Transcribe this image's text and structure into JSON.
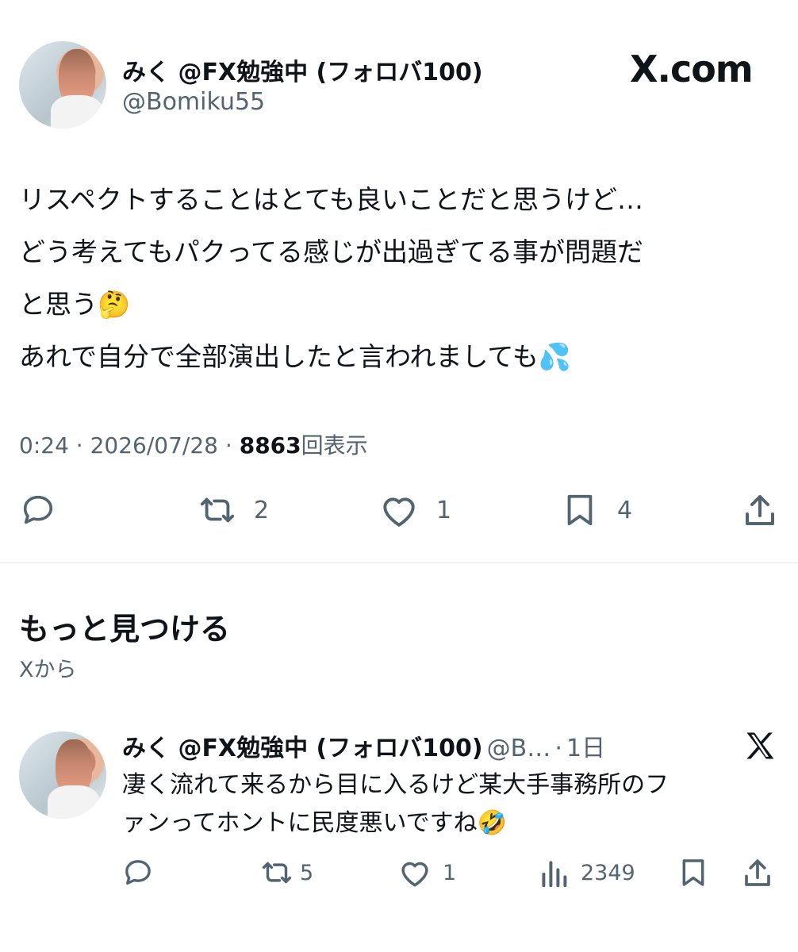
{
  "tweet": {
    "name": "みく @FX勉強中 (フォロバ100)",
    "handle": "@Bomiku55",
    "brand": "X.com",
    "lines": [
      "リスペクトすることはとても良いことだと思うけど…",
      "どう考えてもパクってる感じが出過ぎてる事が問題だ",
      "と思う🤔",
      "あれで自分で全部演出したと言われましても💦"
    ],
    "time": "0:24",
    "date": "2026/07/28",
    "views": "8863",
    "views_label": "回表示",
    "separator": "·",
    "actions": {
      "reply_icon": "reply-icon",
      "retweets": "2",
      "likes": "1",
      "bookmarks": "4",
      "share_icon": "share-icon"
    }
  },
  "discover": {
    "title": "もっと見つける",
    "subtitle": "Xから"
  },
  "related": {
    "name": "みく @FX勉強中 (フォロバ100)",
    "handle": "@B…",
    "separator": "·",
    "age": "1日",
    "lines": [
      "凄く流れて来るから目に入るけど某大手事務所のフ",
      "ァンってホントに民度悪いですね🤣"
    ],
    "actions": {
      "retweets": "5",
      "likes": "1",
      "views": "2349"
    }
  }
}
